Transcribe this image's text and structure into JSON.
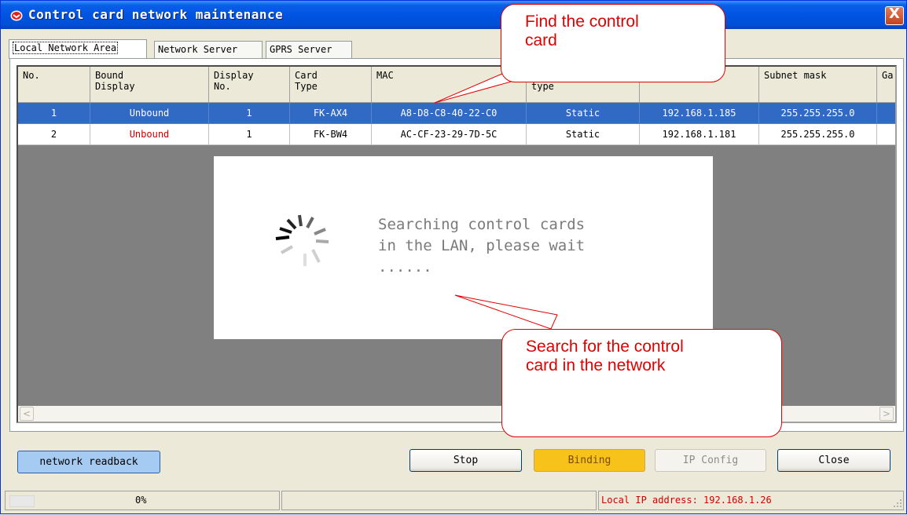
{
  "window": {
    "title": "Control card network maintenance",
    "close_glyph": "X"
  },
  "tabs": [
    {
      "label": "Local Network Area"
    },
    {
      "label": "Network Server"
    },
    {
      "label": "GPRS Server"
    }
  ],
  "table": {
    "columns": [
      "No.",
      "Bound\nDisplay",
      "Display\nNo.",
      "Card\nType",
      "MAC",
      "\ntype",
      "",
      "Subnet mask",
      "Ga"
    ],
    "rows": [
      {
        "no": "1",
        "bound": "Unbound",
        "display_no": "1",
        "card_type": "FK-AX4",
        "mac": "A8-D8-C8-40-22-C0",
        "ip_type": "Static",
        "ip": "192.168.1.185",
        "subnet": "255.255.255.0",
        "selected": true
      },
      {
        "no": "2",
        "bound": "Unbound",
        "display_no": "1",
        "card_type": "FK-BW4",
        "mac": "AC-CF-23-29-7D-5C",
        "ip_type": "Static",
        "ip": "192.168.1.181",
        "subnet": "255.255.255.0",
        "selected": false
      }
    ],
    "scroll_left": "<",
    "scroll_right": ">"
  },
  "loading": {
    "message": "Searching control cards\nin the LAN, please wait\n......"
  },
  "callouts": {
    "find": [
      "Find the control",
      "card"
    ],
    "search": [
      "Search for the control",
      "card in the network"
    ]
  },
  "buttons": {
    "readback": "network readback",
    "stop": "Stop",
    "binding": "Binding",
    "ip_config": "IP Config",
    "close": "Close"
  },
  "status": {
    "progress": "0%",
    "progress_value": 0,
    "local_ip": "Local IP address: 192.168.1.26"
  },
  "colors": {
    "title_bar": "#0054e3",
    "selection": "#316ac5",
    "unbound_red": "#d00000",
    "callout_red": "#e00000",
    "binding_button": "#f7c21a",
    "readback_button": "#a6cbf3"
  },
  "icons": [
    "app-icon",
    "close-icon",
    "loading-spinner-icon",
    "resize-grip-icon"
  ]
}
